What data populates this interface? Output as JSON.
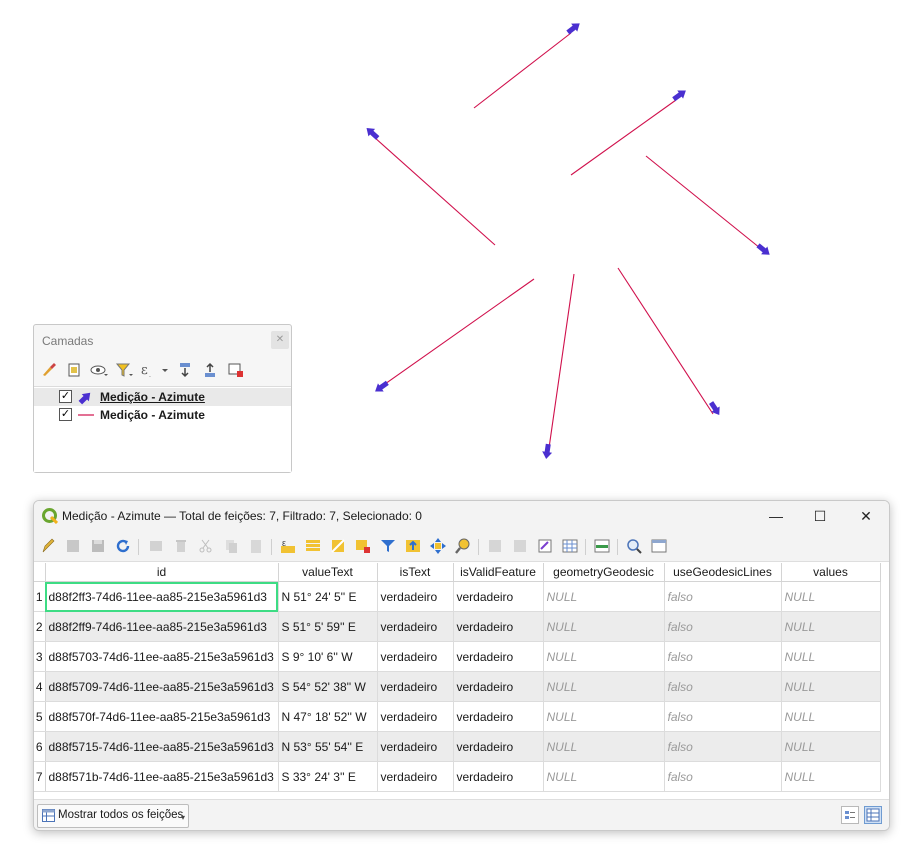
{
  "layers_panel": {
    "title": "Camadas",
    "items": [
      {
        "label": "Medição - Azimute",
        "checked": true,
        "symbol": "arrow-point-symbol-icon"
      },
      {
        "label": "Medição - Azimute",
        "checked": true,
        "symbol": "line-symbol-icon"
      }
    ]
  },
  "attribute_table": {
    "window_title": "Medição - Azimute — Total de feições: 7, Filtrado: 7, Selecionado: 0",
    "columns": [
      "id",
      "valueText",
      "isText",
      "isValidFeature",
      "geometryGeodesic",
      "useGeodesicLines",
      "values"
    ],
    "rows": [
      {
        "n": "1",
        "id": "d88f2ff3-74d6-11ee-aa85-215e3a5961d3",
        "valueText": "N 51° 24' 5'' E",
        "isText": "verdadeiro",
        "isValidFeature": "verdadeiro",
        "geometryGeodesic": "NULL",
        "useGeodesicLines": "falso",
        "values": "NULL"
      },
      {
        "n": "2",
        "id": "d88f2ff9-74d6-11ee-aa85-215e3a5961d3",
        "valueText": "S 51° 5' 59'' E",
        "isText": "verdadeiro",
        "isValidFeature": "verdadeiro",
        "geometryGeodesic": "NULL",
        "useGeodesicLines": "falso",
        "values": "NULL"
      },
      {
        "n": "3",
        "id": "d88f5703-74d6-11ee-aa85-215e3a5961d3",
        "valueText": "S 9° 10' 6'' W",
        "isText": "verdadeiro",
        "isValidFeature": "verdadeiro",
        "geometryGeodesic": "NULL",
        "useGeodesicLines": "falso",
        "values": "NULL"
      },
      {
        "n": "4",
        "id": "d88f5709-74d6-11ee-aa85-215e3a5961d3",
        "valueText": "S 54° 52' 38'' W",
        "isText": "verdadeiro",
        "isValidFeature": "verdadeiro",
        "geometryGeodesic": "NULL",
        "useGeodesicLines": "falso",
        "values": "NULL"
      },
      {
        "n": "5",
        "id": "d88f570f-74d6-11ee-aa85-215e3a5961d3",
        "valueText": "N 47° 18' 52'' W",
        "isText": "verdadeiro",
        "isValidFeature": "verdadeiro",
        "geometryGeodesic": "NULL",
        "useGeodesicLines": "falso",
        "values": "NULL"
      },
      {
        "n": "6",
        "id": "d88f5715-74d6-11ee-aa85-215e3a5961d3",
        "valueText": "N 53° 55' 54'' E",
        "isText": "verdadeiro",
        "isValidFeature": "verdadeiro",
        "geometryGeodesic": "NULL",
        "useGeodesicLines": "falso",
        "values": "NULL"
      },
      {
        "n": "7",
        "id": "d88f571b-74d6-11ee-aa85-215e3a5961d3",
        "valueText": "S 33° 24' 3'' E",
        "isText": "verdadeiro",
        "isValidFeature": "verdadeiro",
        "geometryGeodesic": "NULL",
        "useGeodesicLines": "falso",
        "values": "NULL"
      }
    ],
    "show_features_label": "Mostrar todos os feições"
  },
  "colors": {
    "line": "#d0104c",
    "arrow": "#4a2fd0",
    "focus": "#3ddc84"
  }
}
